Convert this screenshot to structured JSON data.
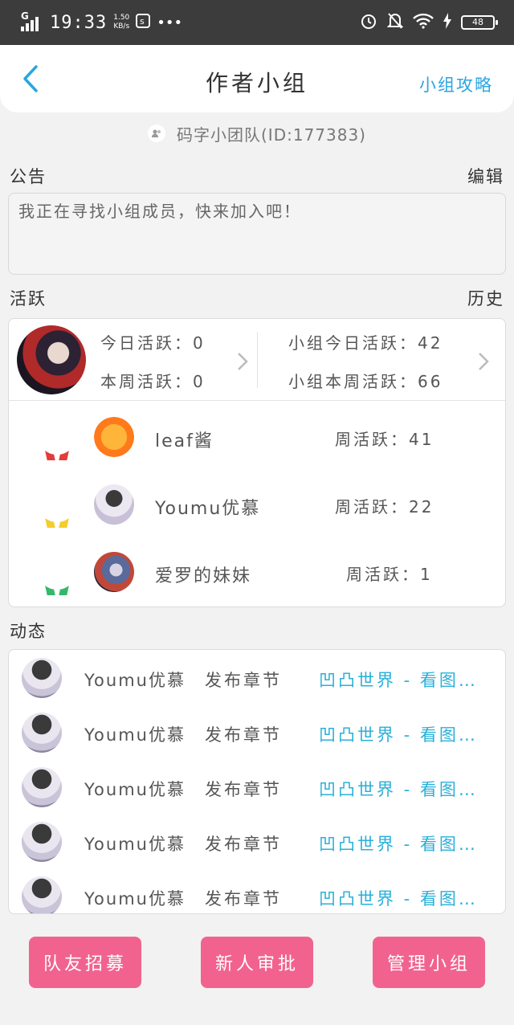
{
  "status_bar": {
    "network": "G",
    "time": "19:33",
    "speed_value": "1.50",
    "speed_unit": "KB/s",
    "notif_icon": "s",
    "more": "•••",
    "battery": "48"
  },
  "header": {
    "title": "作者小组",
    "guide_label": "小组攻略"
  },
  "team": {
    "label": "码字小团队(ID:177383)"
  },
  "notice": {
    "section_label": "公告",
    "edit_label": "编辑",
    "text": "我正在寻找小组成员，快来加入吧！"
  },
  "activity": {
    "section_label": "活跃",
    "history_label": "历史",
    "my_today": "今日活跃：0",
    "my_week": "本周活跃：0",
    "group_today": "小组今日活跃：42",
    "group_week": "小组本周活跃：66",
    "ranking": [
      {
        "rank": "1",
        "name": "leaf酱",
        "weekly": "周活跃：41",
        "color": "#e53b3b"
      },
      {
        "rank": "2",
        "name": "Youmu优慕",
        "weekly": "周活跃：22",
        "color": "#f3cd2b"
      },
      {
        "rank": "3",
        "name": "爱罗的妹妹",
        "weekly": "周活跃：1",
        "color": "#35b86a"
      }
    ]
  },
  "feed": {
    "section_label": "动态",
    "items": [
      {
        "user": "Youmu优慕",
        "action": "发布章节",
        "link": "凹凸世界 - 看图…"
      },
      {
        "user": "Youmu优慕",
        "action": "发布章节",
        "link": "凹凸世界 - 看图…"
      },
      {
        "user": "Youmu优慕",
        "action": "发布章节",
        "link": "凹凸世界 - 看图…"
      },
      {
        "user": "Youmu优慕",
        "action": "发布章节",
        "link": "凹凸世界 - 看图…"
      },
      {
        "user": "Youmu优慕",
        "action": "发布章节",
        "link": "凹凸世界 - 看图…"
      }
    ]
  },
  "buttons": {
    "recruit": "队友招募",
    "approve": "新人审批",
    "manage": "管理小组"
  },
  "colors": {
    "accent": "#2aa6e0",
    "link": "#2ab0d8",
    "button": "#f1638e",
    "status_bar": "#3c3c3c"
  }
}
